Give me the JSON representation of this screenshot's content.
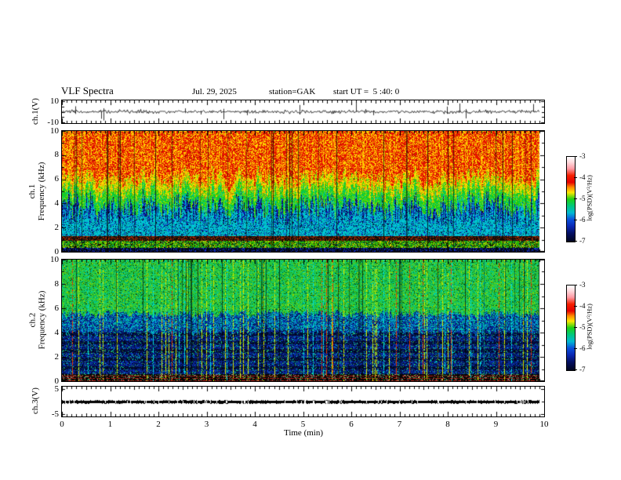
{
  "header": {
    "title": "VLF Spectra",
    "date": "Jul. 29, 2025",
    "station": "station=GAK",
    "start_ut": "start UT =  5 :40: 0"
  },
  "xaxis": {
    "label": "Time (min)",
    "ticks": [
      "0",
      "1",
      "2",
      "3",
      "4",
      "5",
      "6",
      "7",
      "8",
      "9",
      "10"
    ],
    "range": [
      0,
      10
    ],
    "data_end_min": 9.9
  },
  "panels": {
    "ch1_wave": {
      "ylabel": "ch.1(V)",
      "yticks": [
        "10",
        "-10"
      ],
      "ytick_values": [
        10,
        -10
      ]
    },
    "ch1_spec": {
      "ylabel_lines": [
        "ch.1",
        "Frequency (kHz)"
      ],
      "yticks": [
        "10",
        "8",
        "6",
        "4",
        "2",
        "0"
      ],
      "ytick_values": [
        10,
        8,
        6,
        4,
        2,
        0
      ]
    },
    "ch2_spec": {
      "ylabel_lines": [
        "ch.2",
        "Frequency (kHz)"
      ],
      "yticks": [
        "10",
        "8",
        "6",
        "4",
        "2",
        "0"
      ],
      "ytick_values": [
        10,
        8,
        6,
        4,
        2,
        0
      ]
    },
    "ch3_wave": {
      "ylabel": "ch.3(V)",
      "yticks": [
        "5",
        "-5"
      ],
      "ytick_values": [
        5,
        -5
      ]
    }
  },
  "colorbar": {
    "label": "log(PSD)(V²/Hz)",
    "ticks": [
      "-3",
      "-4",
      "-5",
      "-6",
      "-7"
    ],
    "range": [
      -7,
      -3
    ],
    "gradient": [
      [
        0,
        "#ffffff"
      ],
      [
        0.06,
        "#ffdde0"
      ],
      [
        0.14,
        "#ff9aa4"
      ],
      [
        0.22,
        "#f52000"
      ],
      [
        0.3,
        "#e60000"
      ],
      [
        0.36,
        "#ff8c00"
      ],
      [
        0.42,
        "#ffe600"
      ],
      [
        0.5,
        "#1ed214"
      ],
      [
        0.58,
        "#00c87d"
      ],
      [
        0.66,
        "#00b9d2"
      ],
      [
        0.74,
        "#0a50dc"
      ],
      [
        0.82,
        "#0a28b4"
      ],
      [
        0.9,
        "#041064"
      ],
      [
        1,
        "#00041e"
      ]
    ]
  },
  "chart_data": [
    {
      "type": "line",
      "name": "ch.1 waveform",
      "xlabel": "Time (min)",
      "xlim": [
        0,
        10
      ],
      "x_data_end": 9.9,
      "ylabel": "ch.1(V)",
      "ylim": [
        -11,
        11
      ],
      "yticks": [
        10,
        -10
      ],
      "series_description": "continuous broadband noise centered on 0 V, envelope about ±1.5 V, with frequent impulsive spikes reaching ±9 V across the whole 10-minute record"
    },
    {
      "type": "heatmap",
      "name": "ch.1 VLF spectrogram",
      "xlabel": "Time (min)",
      "xlim": [
        0,
        10
      ],
      "x_data_end": 9.9,
      "ylabel": "Frequency (kHz)",
      "ylim": [
        0,
        10
      ],
      "yticks": [
        0,
        2,
        4,
        6,
        8,
        10
      ],
      "colorscale": {
        "label": "log(PSD)(V²/Hz)",
        "min": -7,
        "max": -3
      },
      "features": [
        "high PSD (red, ~-3.5) band from ~6.5 to 10 kHz with yellow speckle",
        "ragged yellow-to-green transition between ~4.5 and 6.5 kHz",
        "low PSD (blue/navy, -6 to -7) below ~4.5 kHz with dense vertical sferic striations",
        "cyan impulsive columns reaching up to ~6 kHz",
        "thin enhanced line near 2 kHz",
        "dark band with red speckle ~0.9-1.3 kHz",
        "enhanced green/yellow band ~0.3-0.9 kHz",
        "very low PSD below ~0.3 kHz"
      ]
    },
    {
      "type": "heatmap",
      "name": "ch.2 VLF spectrogram",
      "xlabel": "Time (min)",
      "xlim": [
        0,
        10
      ],
      "x_data_end": 9.9,
      "ylabel": "Frequency (kHz)",
      "ylim": [
        0,
        10
      ],
      "yticks": [
        0,
        2,
        4,
        6,
        8,
        10
      ],
      "colorscale": {
        "label": "log(PSD)(V²/Hz)",
        "min": -7,
        "max": -3
      },
      "features": [
        "moderate PSD (green, -4.5 to -5) from ~5.7 to 10 kHz crossed by vertical yellow/red streaks",
        "mottled cyan/blue zone ~4.2-5.7 kHz",
        "low PSD (navy/black, -6.5 to -7) from ~0.6 to 4.2 kHz with horizontal banding and thin vertical green/yellow/cyan lines",
        "alternating red/black horizontal stripes below ~0.6 kHz"
      ]
    },
    {
      "type": "line",
      "name": "ch.3 waveform",
      "xlabel": "Time (min)",
      "xlim": [
        0,
        10
      ],
      "x_data_end": 9.9,
      "ylabel": "ch.3(V)",
      "ylim": [
        -6.25,
        6.25
      ],
      "yticks": [
        5,
        -5
      ],
      "series_description": "flat thick trace at 0 V for the entire record (no signal)"
    }
  ],
  "render": {
    "spec1": {
      "seed": 11,
      "red_bottom_khz": 6.2,
      "yellow_band_khz": 1.0,
      "green_band_khz": 1.7,
      "line_khz": 2.03,
      "dark_band_khz": [
        0.92,
        1.32
      ],
      "green_band_low_khz": [
        0.34,
        0.92
      ],
      "palette": {
        "red": "#e61400",
        "orange": "#ff7800",
        "yellow": "#ffd800",
        "yellow2": "#ffc800",
        "darkred": "#8c0a00",
        "yelgreen": "#a0e000",
        "green": "#1ecc14",
        "green2": "#00c864",
        "teal": "#00c896",
        "cyan": "#00c8dc",
        "cyan2": "#00becc",
        "teal2": "#00b4b4",
        "blue": "#1432d2",
        "navy": "#0a1e8c",
        "deep": "#041050",
        "black": "#00050f",
        "bandred": "#aa2800",
        "banddark": "#140a04",
        "banddark2": "#32201a",
        "bandgreen": "#28b400",
        "bandyellow": "#c8d200",
        "bandteal": "#00825a",
        "bottom": "#020a28"
      }
    },
    "spec2": {
      "seed": 22,
      "green_bottom_khz": 5.6,
      "mottle_band_khz": 1.5,
      "stripe_bottom_khz": 0.6,
      "palette": {
        "green": "#2cd23c",
        "teal": "#00c88c",
        "yelgreen": "#96dc00",
        "dgreen": "#0a9628",
        "ddgreen": "#065014",
        "cyan": "#00e0b4",
        "cyan2": "#00aacd",
        "blue": "#0a32b4",
        "navy": "#06207d",
        "deep": "#031249",
        "black": "#010722",
        "yellow": "#d8e600",
        "cyanline": "#00dcdc",
        "redline": "#e63c00",
        "bandred": "#b41e14",
        "banddk": "#0a0505",
        "gray": "#968c82",
        "green3": "#32b446"
      }
    },
    "wave1": {
      "seed": 33,
      "noise_v": 1.5,
      "spike_v_max": 9,
      "spike_prob": 0.022
    },
    "wave3": {
      "seed": 44,
      "value_v": 0
    }
  }
}
